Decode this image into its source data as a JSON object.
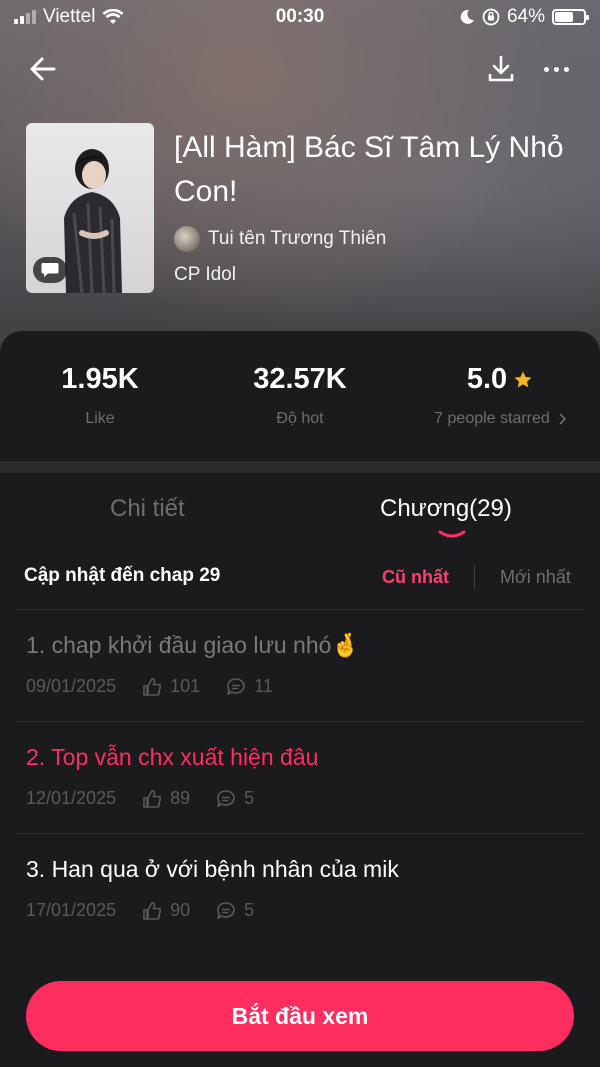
{
  "status": {
    "carrier": "Viettel",
    "time": "00:30",
    "battery": "64%"
  },
  "book": {
    "title": "[All Hàm] Bác Sĩ Tâm Lý Nhỏ Con!",
    "author": "Tui tên Trương Thiên",
    "genre": "CP Idol"
  },
  "stats": {
    "likes": {
      "value": "1.95K",
      "label": "Like"
    },
    "hot": {
      "value": "32.57K",
      "label": "Độ hot"
    },
    "rating": {
      "value": "5.0",
      "label": "7 people starred"
    }
  },
  "tabs": {
    "detail": "Chi tiết",
    "chapters": "Chương(29)"
  },
  "update_bar": {
    "text": "Cập nhật đến chap 29",
    "sort_oldest": "Cũ nhất",
    "sort_newest": "Mới nhất"
  },
  "chapters": [
    {
      "title": "1. chap khởi đầu giao lưu nhó🤞",
      "date": "09/01/2025",
      "likes": "101",
      "comments": "11",
      "state": "read"
    },
    {
      "title": "2. Top vẫn chx xuất hiện đâu",
      "date": "12/01/2025",
      "likes": "89",
      "comments": "5",
      "state": "current"
    },
    {
      "title": "3. Han qua ở với bệnh nhân của mik",
      "date": "17/01/2025",
      "likes": "90",
      "comments": "5",
      "state": "unread"
    }
  ],
  "cta": {
    "label": "Bắt đầu xem"
  },
  "colors": {
    "accent": "#ff2e5f",
    "star": "#f5b524",
    "read": "#7a7a7e",
    "unread": "#ffffff"
  },
  "icons": [
    "back-arrow-icon",
    "download-icon",
    "more-icon",
    "comment-icon",
    "star-icon",
    "chevron-right-icon",
    "thumb-up-icon"
  ]
}
